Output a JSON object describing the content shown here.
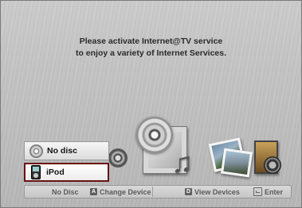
{
  "message": {
    "line1": "Please activate Internet@TV service",
    "line2": "to enjoy a variety of Internet Services."
  },
  "devices": [
    {
      "label": "No disc",
      "icon": "disc-icon",
      "selected": false
    },
    {
      "label": "iPod",
      "icon": "ipod-icon",
      "selected": true
    }
  ],
  "help_bar": {
    "no_disc": "No Disc",
    "change_device_key": "A",
    "change_device": "Change Device",
    "view_devices_key": "D",
    "view_devices": "View Devices",
    "enter": "Enter"
  },
  "colors": {
    "selection_border": "#6a1212",
    "background": "#c0c0c0"
  }
}
